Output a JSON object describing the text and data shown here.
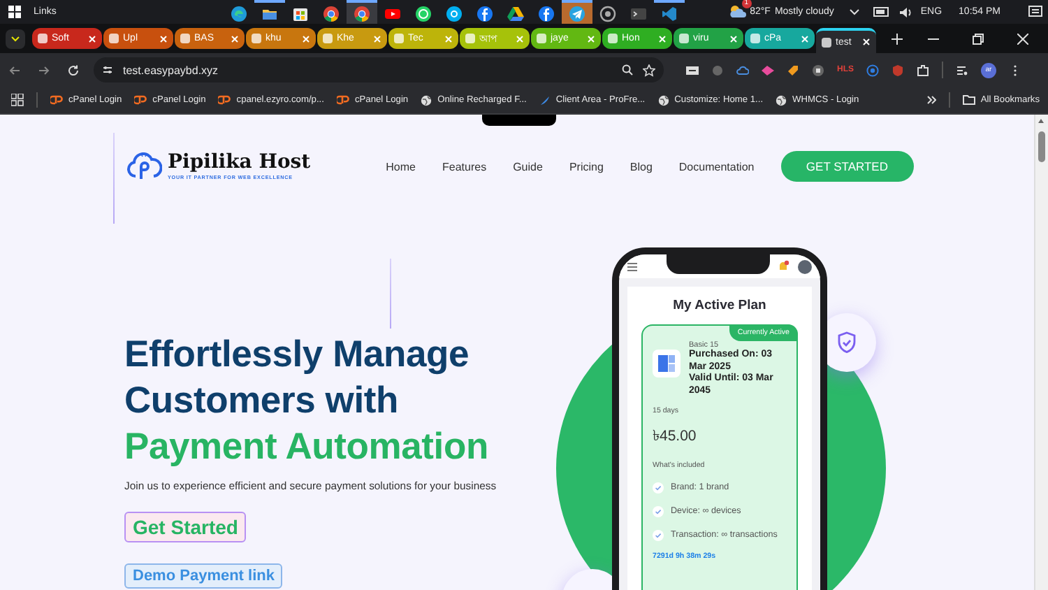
{
  "taskbar": {
    "title": "Links",
    "apps": [
      {
        "kind": "edge",
        "running": false,
        "selected": false
      },
      {
        "kind": "folder",
        "running": true,
        "selected": false
      },
      {
        "kind": "store",
        "running": false,
        "selected": false
      },
      {
        "kind": "chrome",
        "running": false,
        "selected": false
      },
      {
        "kind": "chrome",
        "running": true,
        "selected": true
      },
      {
        "kind": "youtube",
        "running": false,
        "selected": false
      },
      {
        "kind": "whatsapp",
        "running": false,
        "selected": false
      },
      {
        "kind": "skype",
        "running": false,
        "selected": false
      },
      {
        "kind": "facebook",
        "running": false,
        "selected": false
      },
      {
        "kind": "drive",
        "running": false,
        "selected": false
      },
      {
        "kind": "facebook",
        "running": false,
        "selected": false
      },
      {
        "kind": "telegram",
        "running": true,
        "selected": true
      },
      {
        "kind": "chromium",
        "running": false,
        "selected": false
      },
      {
        "kind": "terminal",
        "running": false,
        "selected": false
      },
      {
        "kind": "vscode",
        "running": true,
        "selected": false
      }
    ],
    "weather": {
      "badge": "1",
      "temperature": "82°F",
      "condition": "Mostly cloudy"
    },
    "language": "ENG",
    "time": "10:54 PM"
  },
  "tabs": [
    {
      "label": "Soft",
      "color": "#c8281c",
      "selected": false
    },
    {
      "label": "Upl",
      "color": "#c8500e",
      "selected": false
    },
    {
      "label": "BAS",
      "color": "#c8620e",
      "selected": false
    },
    {
      "label": "khu",
      "color": "#c8760e",
      "selected": false
    },
    {
      "label": "Khe",
      "color": "#c89a10",
      "selected": false
    },
    {
      "label": "Tec",
      "color": "#bdb40a",
      "selected": false
    },
    {
      "label": "আপ",
      "color": "#a6c20a",
      "selected": false
    },
    {
      "label": "jaye",
      "color": "#62b812",
      "selected": false
    },
    {
      "label": "Hon",
      "color": "#2fae22",
      "selected": false
    },
    {
      "label": "viru",
      "color": "#22a246",
      "selected": false
    },
    {
      "label": "cPa",
      "color": "#17a89e",
      "selected": false
    },
    {
      "label": "test",
      "color": "#2a2b2f",
      "selected": true
    }
  ],
  "toolbar": {
    "url": "test.easypaybd.xyz",
    "extension_label": "HLS",
    "profile": "ar"
  },
  "bookmarks": [
    {
      "kind": "cpanel",
      "label": "cPanel Login"
    },
    {
      "kind": "cpanel",
      "label": "cPanel Login"
    },
    {
      "kind": "cpanel",
      "label": "cpanel.ezyro.com/p..."
    },
    {
      "kind": "cpanel",
      "label": "cPanel Login"
    },
    {
      "kind": "globe",
      "label": "Online Recharged F..."
    },
    {
      "kind": "feather",
      "label": "Client Area - ProFre..."
    },
    {
      "kind": "globe",
      "label": "Customize: Home 1..."
    },
    {
      "kind": "globe",
      "label": "WHMCS - Login"
    }
  ],
  "all_bookmarks": "All Bookmarks",
  "site": {
    "brand": "Pipilika Host",
    "tagline": "YOUR IT PARTNER FOR WEB EXCELLENCE",
    "nav": [
      "Home",
      "Features",
      "Guide",
      "Pricing",
      "Blog",
      "Documentation"
    ],
    "cta": "GET STARTED",
    "headline": "Effortlessly Manage Customers with",
    "headline_accent": "Payment Automation",
    "subtitle": "Join us to experience efficient and secure payment solutions for your business",
    "primary_button": "Get Started",
    "secondary_button": "Demo Payment link",
    "plan": {
      "title": "My Active Plan",
      "badge": "Currently Active",
      "name": "Basic 15",
      "purchased": "Purchased On: 03 Mar 2025",
      "valid": "Valid Until: 03 Mar 2045",
      "duration": "15 days",
      "price": "৳45.00",
      "included_label": "What's included",
      "features": [
        "Brand: 1 brand",
        "Device: ∞ devices",
        "Transaction: ∞ transactions"
      ],
      "countdown": "7291d 9h 38m 29s"
    }
  }
}
